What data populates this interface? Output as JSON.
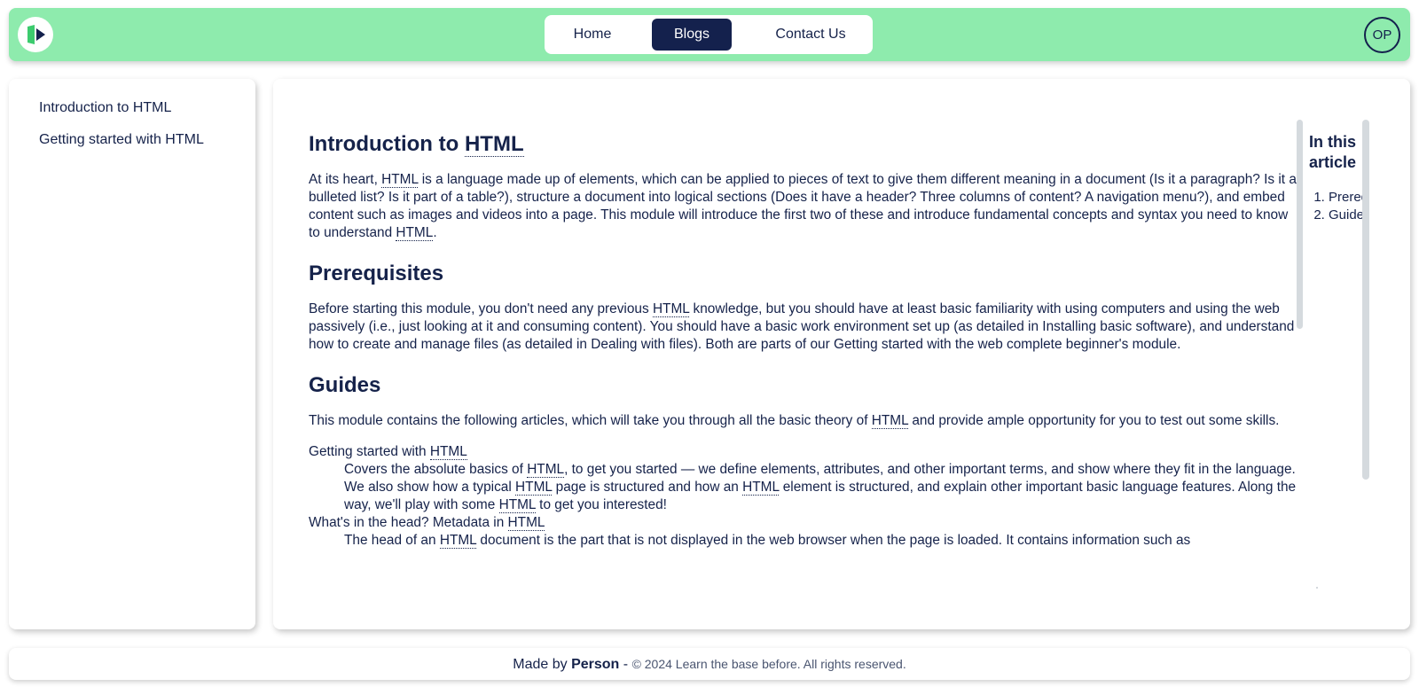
{
  "header": {
    "avatar_initials": "OP",
    "nav": {
      "home": "Home",
      "blogs": "Blogs",
      "contact": "Contact Us"
    },
    "colors": {
      "bar": "#8eebad",
      "active": "#14214d"
    }
  },
  "sidebar": {
    "items": [
      {
        "label": "Introduction to HTML"
      },
      {
        "label": "Getting started with HTML"
      }
    ]
  },
  "article": {
    "title": "Introduction to HTML",
    "abbr": "HTML",
    "intro": {
      "p1": "At its heart, ",
      "p2": " is a language made up of elements, which can be applied to pieces of text to give them different meaning in a document (Is it a paragraph? Is it a bulleted list? Is it part of a table?), structure a document into logical sections (Does it have a header? Three columns of content? A navigation menu?), and embed content such as images and videos into a page. This module will introduce the first two of these and introduce fundamental concepts and syntax you need to know to understand ",
      "p3": "."
    },
    "prereq": {
      "heading": "Prerequisites",
      "p1": "Before starting this module, you don't need any previous ",
      "p2": " knowledge, but you should have at least basic familiarity with using computers and using the web passively (i.e., just looking at it and consuming content). You should have a basic work environment set up (as detailed in Installing basic software), and understand how to create and manage files (as detailed in Dealing with files). Both are parts of our Getting started with the web complete beginner's module."
    },
    "guides": {
      "heading": "Guides",
      "p1": "This module contains the following articles, which will take you through all the basic theory of ",
      "p2": " and provide ample opportunity for you to test out some skills.",
      "items": [
        {
          "title_pre": "Getting started with ",
          "desc": [
            "Covers the absolute basics of ",
            ", to get you started — we define elements, attributes, and other important terms, and show where they fit in the language. We also show how a typical ",
            " page is structured and how an ",
            " element is structured, and explain other important basic language features. Along the way, we'll play with some ",
            " to get you interested!"
          ]
        },
        {
          "title_pre": "What's in the head? Metadata in ",
          "desc": [
            "The head of an ",
            " document is the part that is not displayed in the web browser when the page is loaded. It contains information such as"
          ]
        }
      ]
    }
  },
  "toc": {
    "title": "In this article",
    "items": [
      "Prerequisites",
      "Guides"
    ]
  },
  "footer": {
    "made_by": "Made by",
    "author": "Person",
    "dash": "-",
    "copyright": "© 2024 Learn the base before. All rights reserved."
  }
}
